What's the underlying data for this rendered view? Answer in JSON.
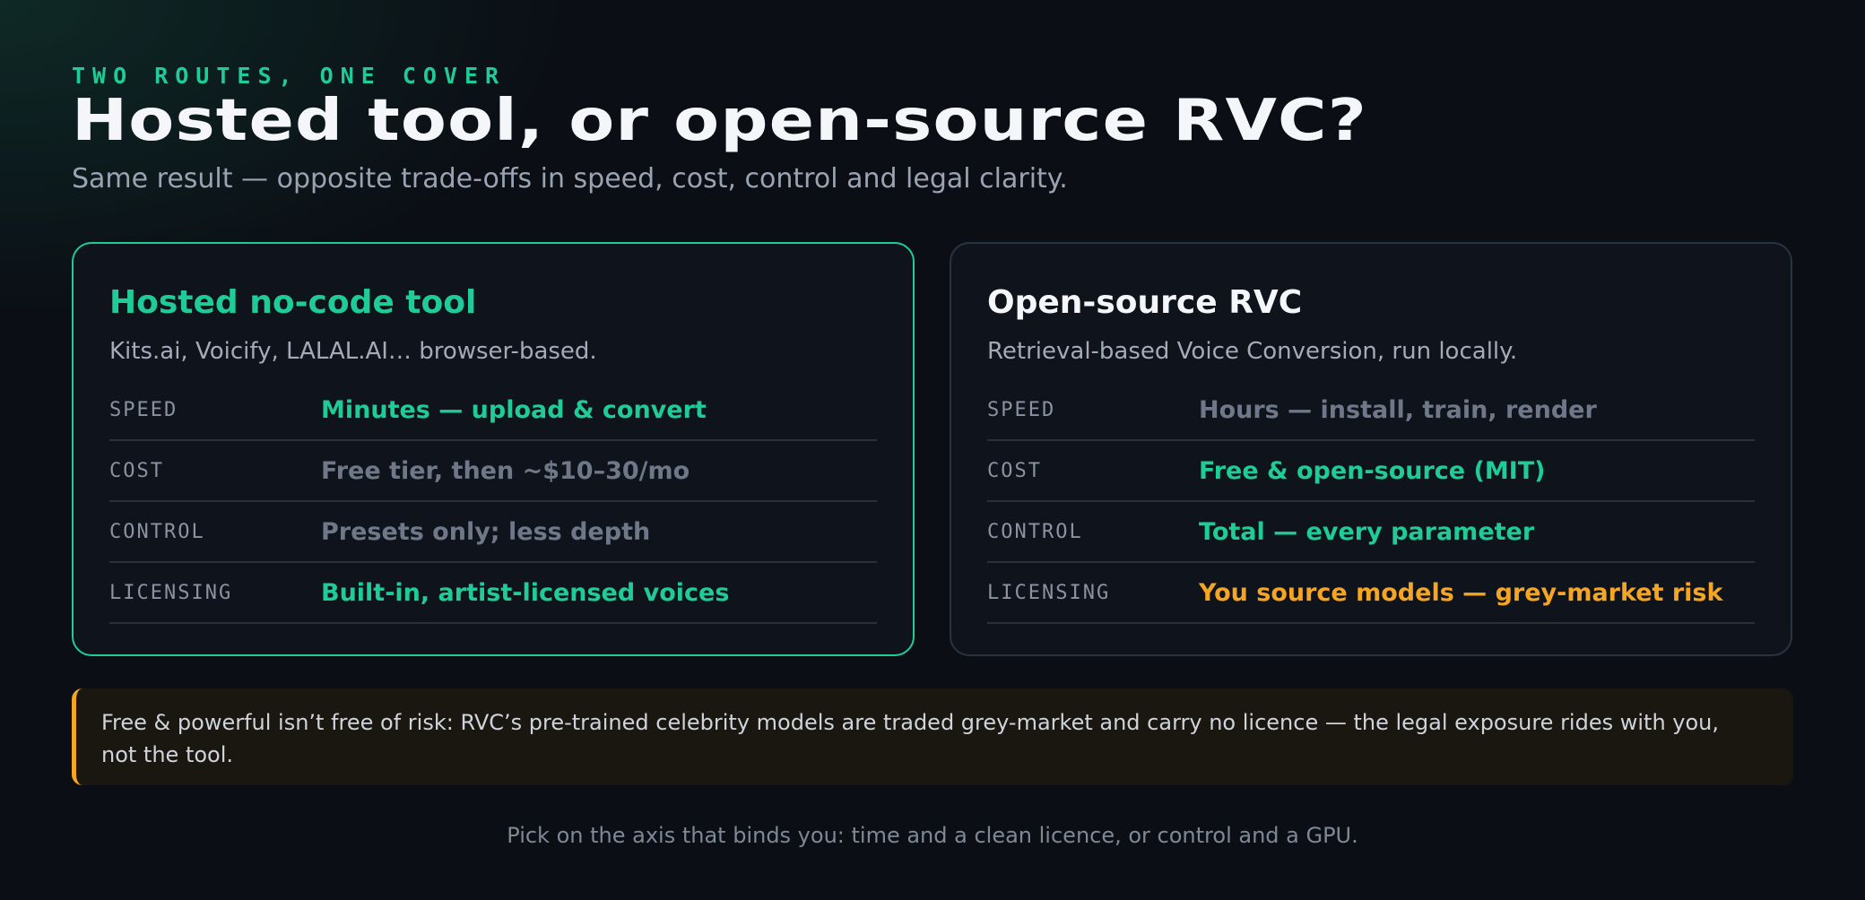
{
  "header": {
    "eyebrow": "TWO ROUTES, ONE COVER",
    "title": "Hosted tool, or open-source RVC?",
    "subtitle": "Same result — opposite trade-offs in speed, cost, control and legal clarity."
  },
  "cards": [
    {
      "title": "Hosted no-code tool",
      "description": "Kits.ai, Voicify, LALAL.AI… browser-based.",
      "accent": "#1fcc98",
      "rows": [
        {
          "key": "SPEED",
          "value": "Minutes — upload & convert",
          "tone": "good"
        },
        {
          "key": "COST",
          "value": "Free tier, then ~$10–30/mo",
          "tone": "muted"
        },
        {
          "key": "CONTROL",
          "value": "Presets only; less depth",
          "tone": "muted"
        },
        {
          "key": "LICENSING",
          "value": "Built-in, artist-licensed voices",
          "tone": "good"
        }
      ]
    },
    {
      "title": "Open-source RVC",
      "description": "Retrieval-based Voice Conversion, run locally.",
      "accent": "#f4f6f9",
      "rows": [
        {
          "key": "SPEED",
          "value": "Hours — install, train, render",
          "tone": "muted"
        },
        {
          "key": "COST",
          "value": "Free & open-source (MIT)",
          "tone": "good"
        },
        {
          "key": "CONTROL",
          "value": "Total — every parameter",
          "tone": "good"
        },
        {
          "key": "LICENSING",
          "value": "You source models — grey-market risk",
          "tone": "warn"
        }
      ]
    }
  ],
  "callout": {
    "text": "Free & powerful isn’t free of risk: RVC’s pre-trained celebrity models are traded grey-market and carry no licence — the legal exposure rides with you, not the tool.",
    "accent": "#f5a524"
  },
  "footer": {
    "text": "Pick on the axis that binds you: time and a clean licence, or control and a GPU."
  },
  "colors": {
    "good": "#1fcc98",
    "muted": "#6f7888",
    "warn": "#f5a524",
    "background": "#0b0f15"
  }
}
